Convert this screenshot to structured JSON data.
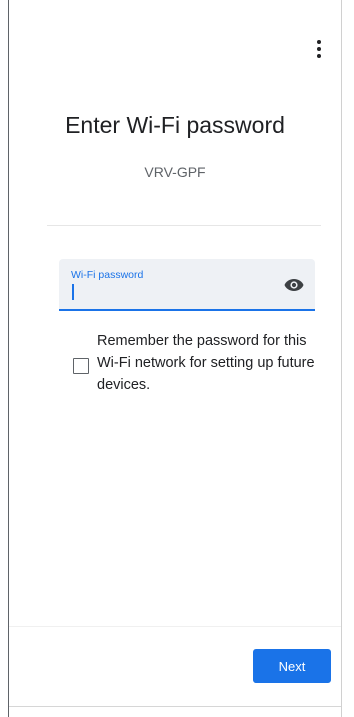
{
  "header": {
    "menu_icon": "more-vert-icon"
  },
  "main": {
    "title": "Enter Wi-Fi password",
    "network_name": "VRV-GPF"
  },
  "password_field": {
    "label": "Wi-Fi password",
    "value": "",
    "visibility_icon": "eye-icon"
  },
  "remember": {
    "checked": false,
    "label": "Remember the password for this Wi-Fi network for setting up future devices."
  },
  "footer": {
    "next_label": "Next"
  },
  "colors": {
    "accent": "#1a73e8",
    "field_background": "#eef1f5",
    "text_primary": "#202124",
    "text_secondary": "#5f6368"
  }
}
